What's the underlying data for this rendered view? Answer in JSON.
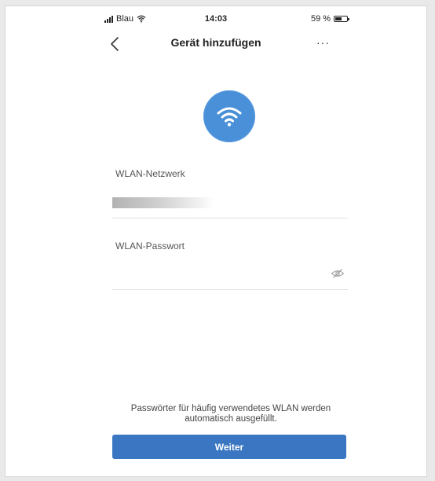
{
  "status_bar": {
    "carrier": "Blau",
    "time": "14:03",
    "battery_text": "59 %",
    "battery_level": 0.59
  },
  "nav": {
    "title": "Gerät hinzufügen",
    "back_icon": "chevron-left-icon",
    "more_label": "···"
  },
  "hero": {
    "icon": "wifi-icon",
    "color": "#4a90d9"
  },
  "form": {
    "network_label": "WLAN-Netzwerk",
    "network_value": "",
    "password_label": "WLAN-Passwort",
    "password_value": "",
    "visibility_icon": "eye-slash-icon"
  },
  "footer": {
    "hint_line1": "Passwörter für häufig verwendetes WLAN werden",
    "hint_line2": "automatisch ausgefüllt.",
    "button_label": "Weiter",
    "button_color": "#3a76c2"
  }
}
